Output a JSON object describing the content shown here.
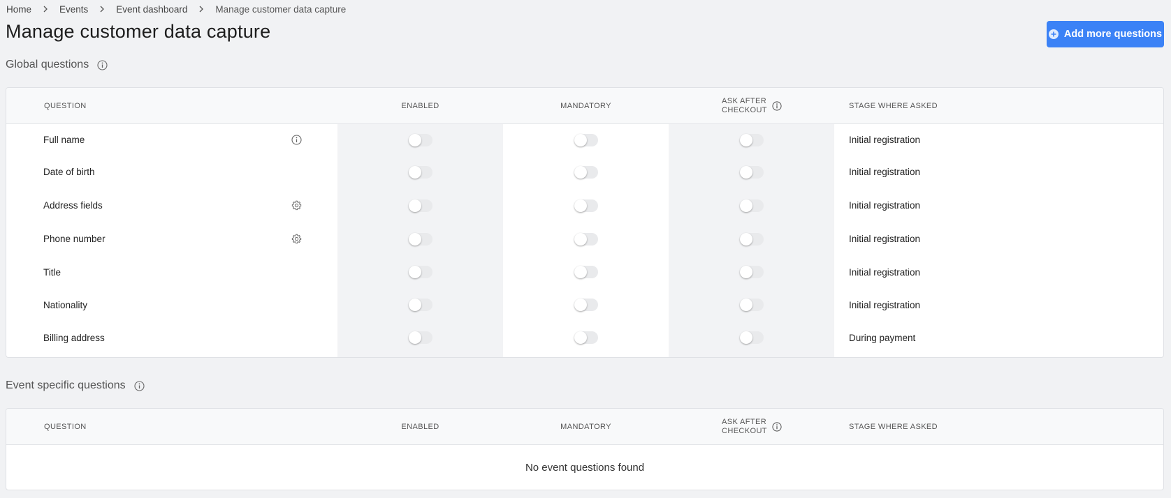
{
  "breadcrumb": [
    "Home",
    "Events",
    "Event dashboard",
    "Manage customer data capture"
  ],
  "page_title": "Manage customer data capture",
  "add_button": {
    "label": "Add more questions",
    "icon": "plus-circle-icon"
  },
  "global": {
    "title": "Global questions",
    "columns": {
      "question": "QUESTION",
      "enabled": "ENABLED",
      "mandatory": "MANDATORY",
      "ask_after_1": "ASK AFTER",
      "ask_after_2": "CHECKOUT",
      "stage": "STAGE WHERE ASKED"
    },
    "rows": [
      {
        "question": "Full name",
        "icon": "info-icon",
        "enabled": false,
        "mandatory": false,
        "ask_after": false,
        "stage": "Initial registration"
      },
      {
        "question": "Date of birth",
        "icon": "",
        "enabled": false,
        "mandatory": false,
        "ask_after": false,
        "stage": "Initial registration"
      },
      {
        "question": "Address fields",
        "icon": "gear-icon",
        "enabled": false,
        "mandatory": false,
        "ask_after": false,
        "stage": "Initial registration"
      },
      {
        "question": "Phone number",
        "icon": "gear-icon",
        "enabled": false,
        "mandatory": false,
        "ask_after": false,
        "stage": "Initial registration"
      },
      {
        "question": "Title",
        "icon": "",
        "enabled": false,
        "mandatory": false,
        "ask_after": false,
        "stage": "Initial registration"
      },
      {
        "question": "Nationality",
        "icon": "",
        "enabled": false,
        "mandatory": false,
        "ask_after": false,
        "stage": "Initial registration"
      },
      {
        "question": "Billing address",
        "icon": "",
        "enabled": false,
        "mandatory": false,
        "ask_after": false,
        "stage": "During payment"
      }
    ]
  },
  "event": {
    "title": "Event specific questions",
    "columns": {
      "question": "QUESTION",
      "enabled": "ENABLED",
      "mandatory": "MANDATORY",
      "ask_after_1": "ASK AFTER",
      "ask_after_2": "CHECKOUT",
      "stage": "STAGE WHERE ASKED"
    },
    "empty_message": "No event questions found"
  },
  "colors": {
    "accent": "#3b82f6",
    "background": "#f1f2f4",
    "toggle_off": "#e9eaec"
  }
}
